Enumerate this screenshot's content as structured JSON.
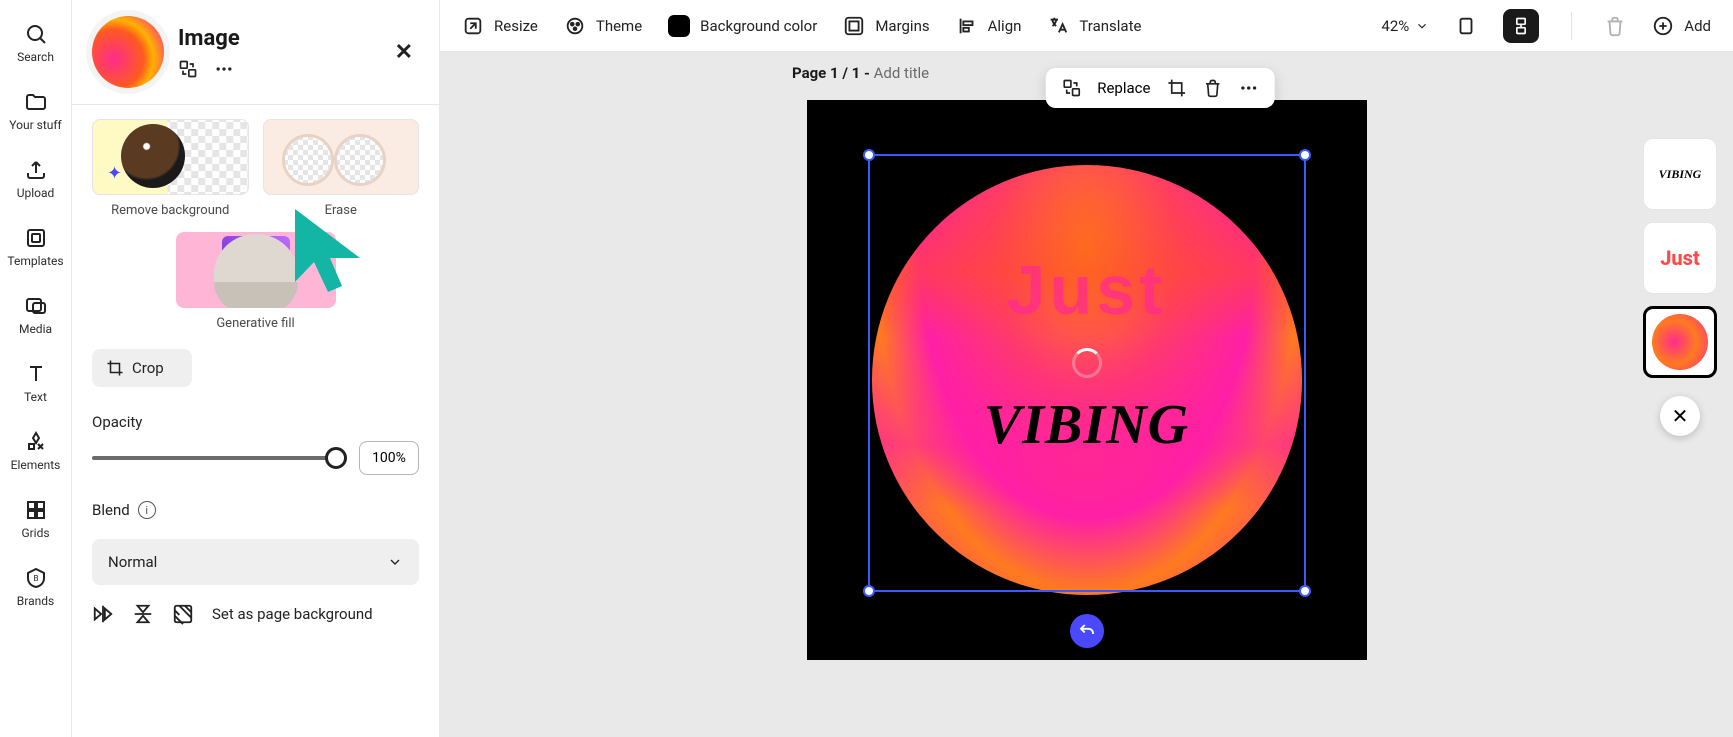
{
  "rail": {
    "search": "Search",
    "your_stuff": "Your stuff",
    "upload": "Upload",
    "templates": "Templates",
    "media": "Media",
    "text": "Text",
    "elements": "Elements",
    "grids": "Grids",
    "brands": "Brands"
  },
  "panel": {
    "title": "Image",
    "remove_bg": "Remove background",
    "erase": "Erase",
    "gen_fill": "Generative fill",
    "crop": "Crop",
    "opacity_label": "Opacity",
    "opacity_value": "100%",
    "blend_label": "Blend",
    "blend_mode": "Normal",
    "set_bg": "Set as page background"
  },
  "toolbar": {
    "resize": "Resize",
    "theme": "Theme",
    "bgcolor": "Background color",
    "margins": "Margins",
    "align": "Align",
    "translate": "Translate",
    "zoom": "42%",
    "add": "Add"
  },
  "canvas": {
    "page_prefix": "Page ",
    "page_num": "1 / 1 - ",
    "add_title": "Add title",
    "replace": "Replace",
    "text_just": "Just",
    "text_vibing": "VIBING"
  },
  "thumbs": {
    "vibing": "VIBING",
    "just": "Just"
  }
}
